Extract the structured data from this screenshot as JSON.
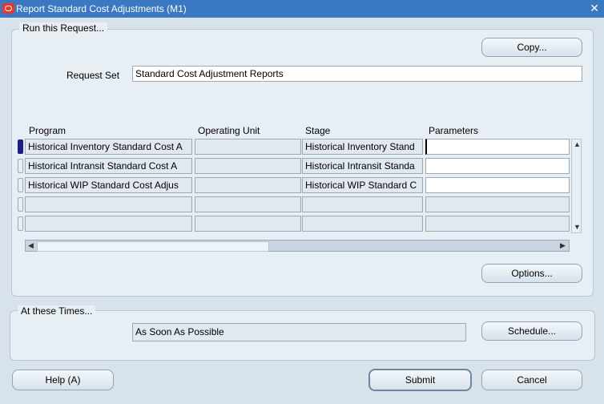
{
  "window": {
    "title": "Report Standard Cost Adjustments (M1)"
  },
  "run_section": {
    "legend": "Run this Request..."
  },
  "buttons": {
    "copy": "Copy...",
    "options": "Options...",
    "schedule": "Schedule...",
    "help": "Help (A)",
    "submit": "Submit",
    "cancel": "Cancel"
  },
  "request_set": {
    "label": "Request Set",
    "value": "Standard Cost Adjustment Reports"
  },
  "table": {
    "headers": {
      "program": "Program",
      "operating_unit": "Operating Unit",
      "stage": "Stage",
      "parameters": "Parameters"
    },
    "rows": [
      {
        "program": "Historical Inventory Standard Cost A",
        "operating_unit": "",
        "stage": "Historical Inventory Stand",
        "parameters": ""
      },
      {
        "program": "Historical Intransit Standard Cost A",
        "operating_unit": "",
        "stage": "Historical Intransit Standa",
        "parameters": ""
      },
      {
        "program": "Historical WIP Standard Cost Adjus",
        "operating_unit": "",
        "stage": "Historical WIP Standard C",
        "parameters": ""
      },
      {
        "program": "",
        "operating_unit": "",
        "stage": "",
        "parameters": ""
      },
      {
        "program": "",
        "operating_unit": "",
        "stage": "",
        "parameters": ""
      }
    ]
  },
  "times_section": {
    "legend": "At these Times...",
    "value": "As Soon As Possible"
  }
}
